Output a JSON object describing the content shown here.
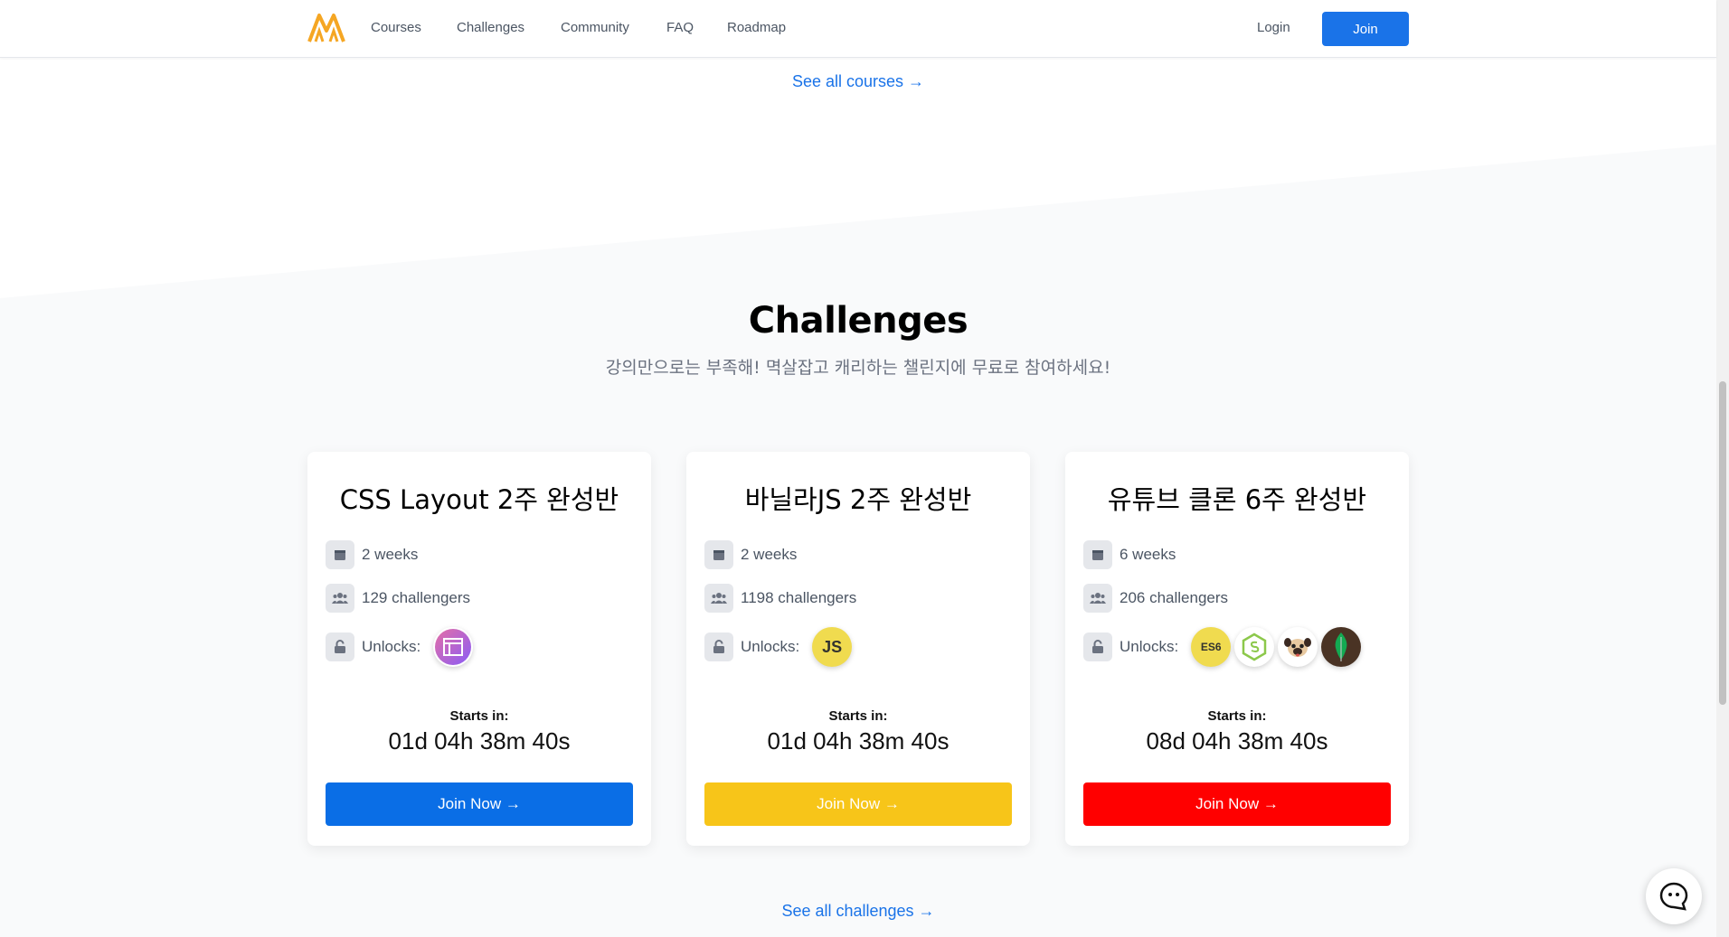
{
  "nav": {
    "links": [
      "Courses",
      "Challenges",
      "Community",
      "FAQ",
      "Roadmap"
    ],
    "login": "Login",
    "join": "Join"
  },
  "courses": {
    "see_all": "See all courses →"
  },
  "challenges": {
    "title": "Challenges",
    "subtitle": "강의만으로는 부족해! 멱살잡고 캐리하는 챌린지에 무료로 참여하세요!",
    "starts_label": "Starts in:",
    "unlocks_label": "Unlocks:",
    "button_label": "Join Now →",
    "see_all": "See all challenges →",
    "cards": [
      {
        "title": "CSS Layout 2주 완성반",
        "duration": "2 weeks",
        "challengers": "129 challengers",
        "countdown": "01d 04h 38m 40s",
        "button_color": "#0a6ee6",
        "unlocks": [
          "layout-icon"
        ]
      },
      {
        "title": "바닐라JS 2주 완성반",
        "duration": "2 weeks",
        "challengers": "1198 challengers",
        "countdown": "01d 04h 38m 40s",
        "button_color": "#f7c519",
        "unlocks": [
          "js-icon"
        ],
        "js_text": "JS"
      },
      {
        "title": "유튜브 클론 6주 완성반",
        "duration": "6 weeks",
        "challengers": "206 challengers",
        "countdown": "08d 04h 38m 40s",
        "button_color": "#ff0000",
        "unlocks": [
          "es6-icon",
          "nodejs-icon",
          "pug-icon",
          "mongodb-icon"
        ],
        "es6_text": "ES6"
      }
    ]
  }
}
